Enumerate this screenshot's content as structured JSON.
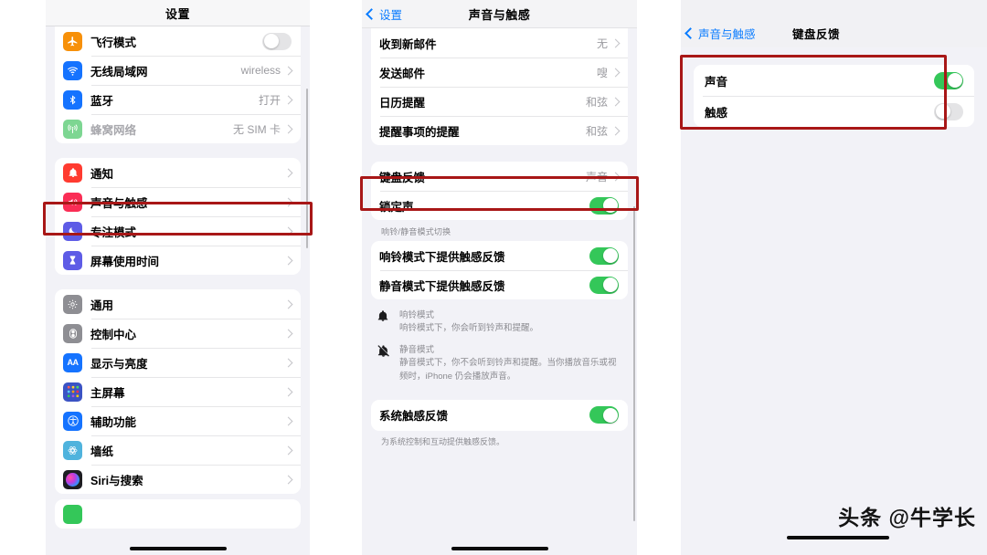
{
  "watermark": "头条 @牛学长",
  "colors": {
    "switch_on": "#34c759",
    "switch_off": "#e4e4e6",
    "accent_blue": "#0a7cff",
    "highlight_red": "#a81717",
    "panel_bg": "#f2f2f7"
  },
  "panel1": {
    "nav": {
      "title": "设置"
    },
    "group1": [
      {
        "label": "飞行模式",
        "icon": "airplane-icon",
        "icon_color": "#f79009",
        "type": "switch",
        "value": "off"
      },
      {
        "label": "无线局域网",
        "icon": "wifi-icon",
        "icon_color": "#1573ff",
        "type": "link",
        "value": "wireless"
      },
      {
        "label": "蓝牙",
        "icon": "bluetooth-icon",
        "icon_color": "#1573ff",
        "type": "link",
        "value": "打开"
      },
      {
        "label": "蜂窝网络",
        "icon": "cellular-icon",
        "icon_color": "#7dd692",
        "type": "link",
        "value": "无 SIM 卡",
        "dim": true
      }
    ],
    "group2": [
      {
        "label": "通知",
        "icon": "bell-icon",
        "icon_color": "#ff3b30",
        "type": "link",
        "value": ""
      },
      {
        "label": "声音与触感",
        "icon": "speaker-icon",
        "icon_color": "#fa2d55",
        "type": "link",
        "value": ""
      },
      {
        "label": "专注模式",
        "icon": "moon-icon",
        "icon_color": "#5e5ce6",
        "type": "link",
        "value": ""
      },
      {
        "label": "屏幕使用时间",
        "icon": "hourglass-icon",
        "icon_color": "#5e5ce6",
        "type": "link",
        "value": ""
      }
    ],
    "group3": [
      {
        "label": "通用",
        "icon": "gear-icon",
        "icon_color": "#8e8e93",
        "type": "link",
        "value": ""
      },
      {
        "label": "控制中心",
        "icon": "control-center-icon",
        "icon_color": "#8e8e93",
        "type": "link",
        "value": ""
      },
      {
        "label": "显示与亮度",
        "icon": "display-aa-icon",
        "icon_color": "#1573ff",
        "type": "link",
        "value": ""
      },
      {
        "label": "主屏幕",
        "icon": "home-screen-icon",
        "icon_color": "#3b53c4",
        "type": "link",
        "value": ""
      },
      {
        "label": "辅助功能",
        "icon": "accessibility-icon",
        "icon_color": "#1573ff",
        "type": "link",
        "value": ""
      },
      {
        "label": "墙纸",
        "icon": "wallpaper-icon",
        "icon_color": "#4fb3dd",
        "type": "link",
        "value": ""
      },
      {
        "label": "Siri与搜索",
        "icon": "siri-icon",
        "icon_color": "#2b2b33",
        "type": "link",
        "value": ""
      }
    ]
  },
  "panel2": {
    "nav": {
      "back": "设置",
      "title": "声音与触感"
    },
    "group1": [
      {
        "label": "收到新邮件",
        "type": "link",
        "value": "无"
      },
      {
        "label": "发送邮件",
        "type": "link",
        "value": "嗖"
      },
      {
        "label": "日历提醒",
        "type": "link",
        "value": "和弦"
      },
      {
        "label": "提醒事项的提醒",
        "type": "link",
        "value": "和弦"
      }
    ],
    "group2": [
      {
        "label": "键盘反馈",
        "type": "link",
        "value": "声音"
      },
      {
        "label": "锁定声",
        "type": "switch",
        "value": "on"
      }
    ],
    "group3_header": "响铃/静音模式切换",
    "group3": [
      {
        "label": "响铃模式下提供触感反馈",
        "type": "switch",
        "value": "on"
      },
      {
        "label": "静音模式下提供触感反馈",
        "type": "switch",
        "value": "on"
      }
    ],
    "notes": [
      {
        "icon": "bell-icon",
        "title": "响铃模式",
        "body": "响铃模式下，你会听到铃声和提醒。"
      },
      {
        "icon": "bell-slash-icon",
        "title": "静音模式",
        "body": "静音模式下，你不会听到铃声和提醒。当你播放音乐或视频时，iPhone 仍会播放声音。"
      }
    ],
    "group4": [
      {
        "label": "系统触感反馈",
        "type": "switch",
        "value": "on"
      }
    ],
    "footnote": "为系统控制和互动提供触感反馈。"
  },
  "panel3": {
    "nav": {
      "back": "声音与触感",
      "title": "键盘反馈"
    },
    "group1": [
      {
        "label": "声音",
        "type": "switch",
        "value": "on"
      },
      {
        "label": "触感",
        "type": "switch",
        "value": "off"
      }
    ]
  }
}
